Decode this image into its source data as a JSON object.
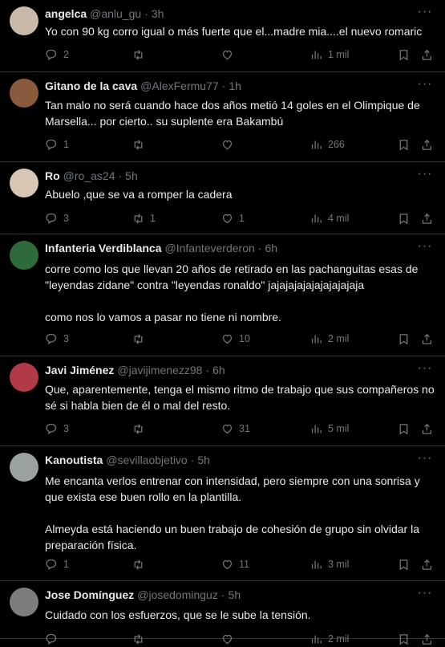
{
  "tweets": [
    {
      "name": "angelca",
      "handle": "@anlu_gu",
      "time": "3h",
      "paragraphs": [
        "Yo con 90 kg corro igual o más fuerte que el...madre mia....el nuevo romaric"
      ],
      "replies": "2",
      "retweets": "",
      "likes": "",
      "views": "1 mil",
      "avatar_color": "#c9b9a8"
    },
    {
      "name": "Gitano de la cava",
      "handle": "@AlexFermu77",
      "time": "1h",
      "paragraphs": [
        "Tan malo no será cuando hace dos años metió 14 goles en el Olimpique de Marsella... por cierto.. su suplente era Bakambú"
      ],
      "replies": "1",
      "retweets": "",
      "likes": "",
      "views": "266",
      "avatar_color": "#8a5a3c"
    },
    {
      "name": "Ro",
      "handle": "@ro_as24",
      "time": "5h",
      "paragraphs": [
        "Abuelo ,que se va a romper la cadera"
      ],
      "replies": "3",
      "retweets": "1",
      "likes": "1",
      "views": "4 mil",
      "avatar_color": "#d9c7b5"
    },
    {
      "name": "Infanteria Verdiblanca",
      "handle": "@Infanteverderon",
      "time": "6h",
      "paragraphs": [
        "corre como los que llevan 20 años de retirado en las pachanguitas esas de \"leyendas zidane\" contra \"leyendas ronaldo\" jajajajajajajajajajaja",
        "como nos lo vamos a pasar no tiene ni nombre."
      ],
      "replies": "3",
      "retweets": "",
      "likes": "10",
      "views": "2 mil",
      "avatar_color": "#2e6b3a"
    },
    {
      "name": "Javi Jiménez",
      "handle": "@javijimenezz98",
      "time": "6h",
      "paragraphs": [
        "Que, aparentemente, tenga el mismo ritmo de trabajo que sus compañeros no sé si habla bien de él o mal del resto."
      ],
      "replies": "3",
      "retweets": "",
      "likes": "31",
      "views": "5 mil",
      "avatar_color": "#b23a48"
    },
    {
      "name": "Kanoutista",
      "handle": "@sevillaobjetivo",
      "time": "5h",
      "paragraphs": [
        "Me encanta verlos entrenar con intensidad, pero siempre con una sonrisa y que exista ese buen rollo en la plantilla.",
        "Almeyda está haciendo un buen trabajo de cohesión de grupo sin olvidar la preparación física."
      ],
      "replies": "1",
      "retweets": "",
      "likes": "11",
      "views": "3 mil",
      "avatar_color": "#9aa3a0"
    },
    {
      "name": "Jose Domínguez",
      "handle": "@josedominguz",
      "time": "5h",
      "paragraphs": [
        "Cuidado con los esfuerzos, que se le sube la tensión."
      ],
      "replies": "",
      "retweets": "",
      "likes": "",
      "views": "2 mil",
      "avatar_color": "#7d7d7d"
    }
  ]
}
